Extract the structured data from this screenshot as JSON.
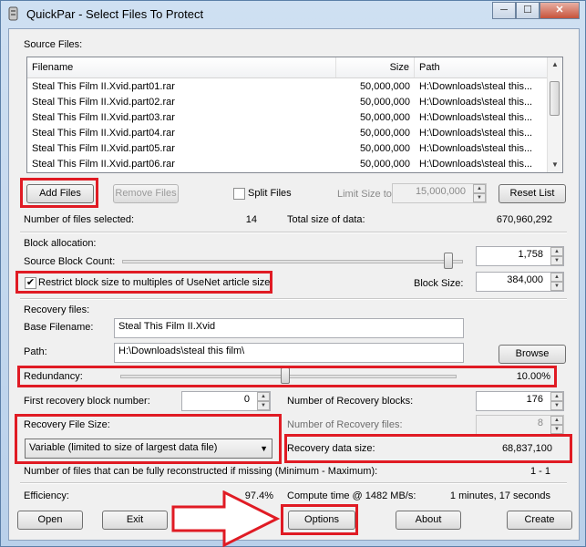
{
  "window": {
    "title": "QuickPar - Select Files To Protect",
    "controls": [
      "─",
      "☐",
      "✕"
    ]
  },
  "source_files": {
    "group_label": "Source Files:",
    "columns": [
      "Filename",
      "Size",
      "Path"
    ],
    "rows": [
      {
        "filename": "Steal This Film II.Xvid.part01.rar",
        "size": "50,000,000",
        "path": "H:\\Downloads\\steal this..."
      },
      {
        "filename": "Steal This Film II.Xvid.part02.rar",
        "size": "50,000,000",
        "path": "H:\\Downloads\\steal this..."
      },
      {
        "filename": "Steal This Film II.Xvid.part03.rar",
        "size": "50,000,000",
        "path": "H:\\Downloads\\steal this..."
      },
      {
        "filename": "Steal This Film II.Xvid.part04.rar",
        "size": "50,000,000",
        "path": "H:\\Downloads\\steal this..."
      },
      {
        "filename": "Steal This Film II.Xvid.part05.rar",
        "size": "50,000,000",
        "path": "H:\\Downloads\\steal this..."
      },
      {
        "filename": "Steal This Film II.Xvid.part06.rar",
        "size": "50,000,000",
        "path": "H:\\Downloads\\steal this..."
      }
    ],
    "add_files": "Add Files",
    "remove_files": "Remove Files",
    "split_files": "Split Files",
    "limit_size_label": "Limit Size to:",
    "limit_size_value": "15,000,000",
    "reset_list": "Reset List",
    "files_selected_label": "Number of files selected:",
    "files_selected_value": "14",
    "total_size_label": "Total size of data:",
    "total_size_value": "670,960,292"
  },
  "block_allocation": {
    "group_label": "Block allocation:",
    "count_label": "Source Block Count:",
    "count_value": "1,758",
    "count_slider_level": 0.97,
    "restrict_label": "Restrict block size to multiples of UseNet article size",
    "restrict_checked": true,
    "block_size_label": "Block Size:",
    "block_size_value": "384,000"
  },
  "recovery": {
    "group_label": "Recovery files:",
    "base_label": "Base Filename:",
    "base_value": "Steal This Film II.Xvid",
    "path_label": "Path:",
    "path_value": "H:\\Downloads\\steal this film\\",
    "browse": "Browse",
    "redundancy_label": "Redundancy:",
    "redundancy_value": "10.00%",
    "redundancy_level": 0.1,
    "first_block_label": "First recovery block number:",
    "first_block_value": "0",
    "num_blocks_label": "Number of Recovery blocks:",
    "num_blocks_value": "176",
    "file_size_label": "Recovery File Size:",
    "num_files_label": "Number of Recovery files:",
    "num_files_value": "8",
    "file_size_option": "Variable (limited to size of largest data file)",
    "data_size_label": "Recovery data size:",
    "data_size_value": "68,837,100",
    "reconstruct_label": "Number of files that can be fully reconstructed if missing (Minimum - Maximum):",
    "reconstruct_value": "1 - 1"
  },
  "status": {
    "efficiency_label": "Efficiency:",
    "efficiency_value": "97.4%",
    "compute_label": "Compute time @ 1482 MB/s:",
    "compute_value": "1 minutes, 17 seconds"
  },
  "buttons": {
    "open": "Open",
    "exit": "Exit",
    "options": "Options",
    "about": "About",
    "create": "Create"
  },
  "colors": {
    "highlight": "#e01b24",
    "window_bg": "#f0f0f0",
    "title_bg": "#cfe0f2"
  },
  "icons": {
    "app": "quickpar-icon",
    "scroll_up": "▲",
    "scroll_down": "▼",
    "dropdown": "▼",
    "spin_up": "▲",
    "spin_down": "▼"
  }
}
